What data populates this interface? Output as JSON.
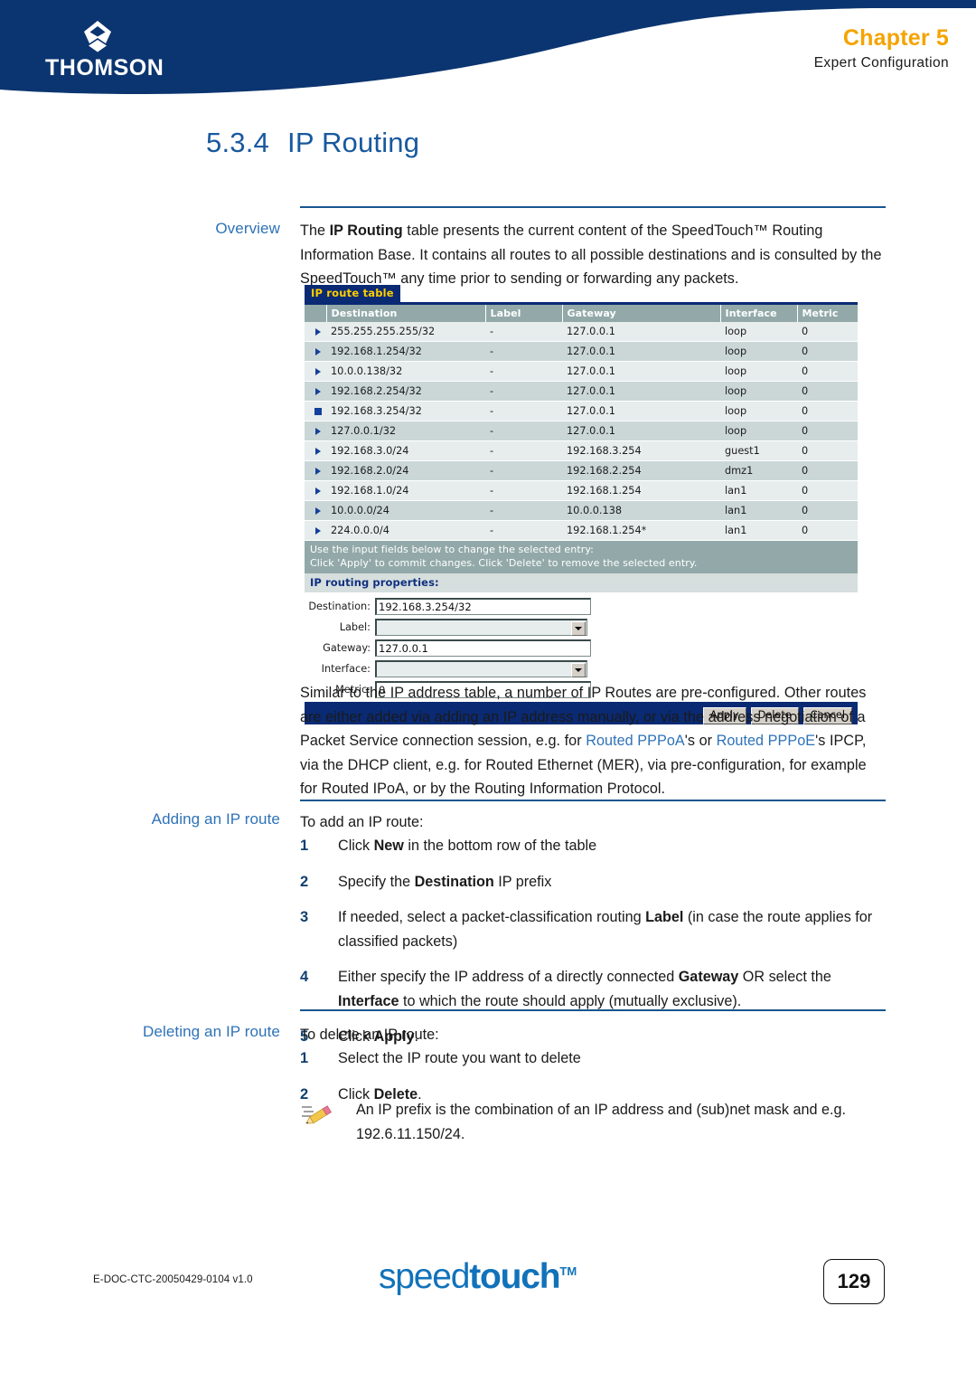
{
  "header": {
    "brand": "THOMSON",
    "chapter": "Chapter 5",
    "chapter_sub": "Expert Configuration",
    "accent_color": "#F5A300",
    "band_color": "#0B3570"
  },
  "title": {
    "number": "5.3.4",
    "text": "IP Routing"
  },
  "sections": {
    "overview_label": "Overview",
    "overview_p1": "The IP Routing table presents the current content of the SpeedTouch™ Routing Information Base. It contains all routes to all possible destinations and is consulted by the SpeedTouch™ any time prior to sending or forwarding any packets.",
    "after_shot_p": "Similar to the IP address table, a number of IP Routes are pre-configured. Other routes are either added via adding an IP address manually, or via the address negotiation of a Packet Service connection session, e.g. for Routed PPPoA's or Routed PPPoE's IPCP, via the DHCP client, e.g. for Routed Ethernet (MER), via pre-configuration, for example for Routed IPoA, or by the Routing Information Protocol.",
    "adding_label": "Adding an IP route",
    "adding_intro": "To add an IP route:",
    "adding_steps": [
      {
        "n": "1",
        "text": "Click New in the bottom row of the table"
      },
      {
        "n": "2",
        "text": "Specify the Destination IP prefix"
      },
      {
        "n": "3",
        "text": "If needed, select a packet-classification routing Label (in case the route applies for classified packets)"
      },
      {
        "n": "4",
        "text": "Either specify the IP address of a directly connected Gateway OR select the Interface to which the route should apply (mutually exclusive)."
      },
      {
        "n": "5",
        "text": "Click Apply."
      }
    ],
    "deleting_label": "Deleting an IP route",
    "deleting_intro": "To delete an IP route:",
    "deleting_steps": [
      {
        "n": "1",
        "text": "Select the IP route you want to delete"
      },
      {
        "n": "2",
        "text": "Click Delete."
      }
    ],
    "note_text": "An IP prefix is the combination of an IP address and (sub)net mask and e.g. 192.6.11.150/24."
  },
  "screenshot": {
    "tab_label": "IP route table",
    "tab_bg": "#0A2A73",
    "tab_fg": "#FFCC00",
    "columns": [
      "",
      "Destination",
      "Label",
      "Gateway",
      "Interface",
      "Metric"
    ],
    "rows": [
      {
        "marker": "arrow",
        "destination": "255.255.255.255/32",
        "label": "-",
        "gateway": "127.0.0.1",
        "interface": "loop",
        "metric": "0"
      },
      {
        "marker": "arrow",
        "destination": "192.168.1.254/32",
        "label": "-",
        "gateway": "127.0.0.1",
        "interface": "loop",
        "metric": "0"
      },
      {
        "marker": "arrow",
        "destination": "10.0.0.138/32",
        "label": "-",
        "gateway": "127.0.0.1",
        "interface": "loop",
        "metric": "0"
      },
      {
        "marker": "arrow",
        "destination": "192.168.2.254/32",
        "label": "-",
        "gateway": "127.0.0.1",
        "interface": "loop",
        "metric": "0"
      },
      {
        "marker": "square",
        "destination": "192.168.3.254/32",
        "label": "-",
        "gateway": "127.0.0.1",
        "interface": "loop",
        "metric": "0"
      },
      {
        "marker": "arrow",
        "destination": "127.0.0.1/32",
        "label": "-",
        "gateway": "127.0.0.1",
        "interface": "loop",
        "metric": "0"
      },
      {
        "marker": "arrow",
        "destination": "192.168.3.0/24",
        "label": "-",
        "gateway": "192.168.3.254",
        "interface": "guest1",
        "metric": "0"
      },
      {
        "marker": "arrow",
        "destination": "192.168.2.0/24",
        "label": "-",
        "gateway": "192.168.2.254",
        "interface": "dmz1",
        "metric": "0"
      },
      {
        "marker": "arrow",
        "destination": "192.168.1.0/24",
        "label": "-",
        "gateway": "192.168.1.254",
        "interface": "lan1",
        "metric": "0"
      },
      {
        "marker": "arrow",
        "destination": "10.0.0.0/24",
        "label": "-",
        "gateway": "10.0.0.138",
        "interface": "lan1",
        "metric": "0"
      },
      {
        "marker": "arrow",
        "destination": "224.0.0.0/4",
        "label": "-",
        "gateway": "192.168.1.254*",
        "interface": "lan1",
        "metric": "0"
      }
    ],
    "hint_line1": "Use the input fields below to change the selected entry:",
    "hint_line2": "Click 'Apply' to commit changes. Click 'Delete' to remove the selected entry.",
    "properties_header": "IP routing properties:",
    "form": [
      {
        "label": "Destination:",
        "type": "text",
        "value": "192.168.3.254/32"
      },
      {
        "label": "Label:",
        "type": "select",
        "value": ""
      },
      {
        "label": "Gateway:",
        "type": "text",
        "value": "127.0.0.1"
      },
      {
        "label": "Interface:",
        "type": "select",
        "value": ""
      },
      {
        "label": "Metric:",
        "type": "text",
        "value": "0"
      }
    ],
    "buttons": [
      "Apply",
      "Delete",
      "Cancel"
    ]
  },
  "footer": {
    "doc_id": "E-DOC-CTC-20050429-0104 v1.0",
    "logo_light": "speed",
    "logo_bold": "touch",
    "logo_tm": "TM",
    "page": "129"
  }
}
